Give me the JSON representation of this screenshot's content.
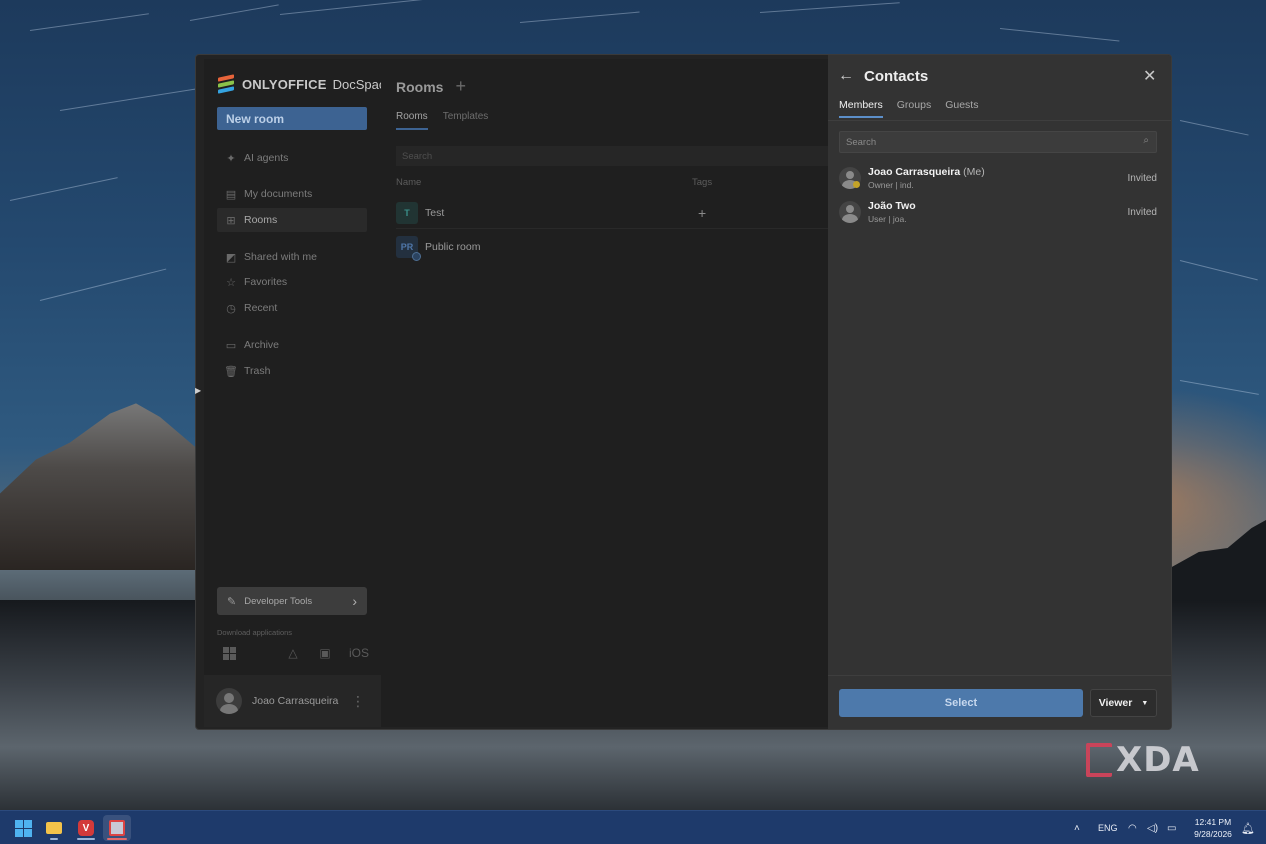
{
  "app": {
    "brand": "ONLYOFFICE",
    "product": "DocSpace",
    "new_room_label": "New room",
    "nav": [
      {
        "label": "AI agents",
        "icon": "sparkle-icon"
      },
      {
        "label": "My documents",
        "icon": "document-icon"
      },
      {
        "label": "Rooms",
        "icon": "rooms-grid-icon",
        "active": true
      },
      {
        "label": "Shared with me",
        "icon": "shared-icon"
      },
      {
        "label": "Favorites",
        "icon": "star-icon"
      },
      {
        "label": "Recent",
        "icon": "clock-icon"
      },
      {
        "label": "Archive",
        "icon": "archive-icon"
      },
      {
        "label": "Trash",
        "icon": "trash-icon"
      }
    ],
    "developer_tools_label": "Developer Tools",
    "download_label": "Download applications",
    "download_apps": [
      "Windows",
      "macOS",
      "Linux",
      "Android",
      "iOS"
    ],
    "user_name": "Joao Carrasqueira"
  },
  "main": {
    "title": "Rooms",
    "tabs": [
      "Rooms",
      "Templates"
    ],
    "search_placeholder": "Search",
    "columns": [
      "Name",
      "Tags"
    ],
    "rooms": [
      {
        "initials": "T",
        "name": "Test",
        "color": "#3a8f8a",
        "bg": "#213433"
      },
      {
        "initials": "PR",
        "name": "Public room",
        "color": "#4f76a8",
        "bg": "#23303f"
      }
    ]
  },
  "contacts_panel": {
    "title": "Contacts",
    "tabs": [
      "Members",
      "Groups",
      "Guests"
    ],
    "active_tab": "Members",
    "search_placeholder": "Search",
    "members": [
      {
        "name": "Joao Carrasqueira",
        "me_suffix": "(Me)",
        "subtitle": "Owner | ind.",
        "status": "Invited",
        "owner": true
      },
      {
        "name": "João Two",
        "me_suffix": "",
        "subtitle": "User | joa.",
        "status": "Invited",
        "owner": false
      }
    ],
    "select_label": "Select",
    "role_label": "Viewer"
  },
  "watermark": "XDA",
  "taskbar": {
    "language": "ENG",
    "time": "12:41 PM",
    "date": "9/28/2026"
  },
  "colors": {
    "accent": "#4d79ab",
    "tab_underline": "#5c8fc9",
    "owner_badge": "#c4a328",
    "taskbar": "#1e3a6b"
  }
}
